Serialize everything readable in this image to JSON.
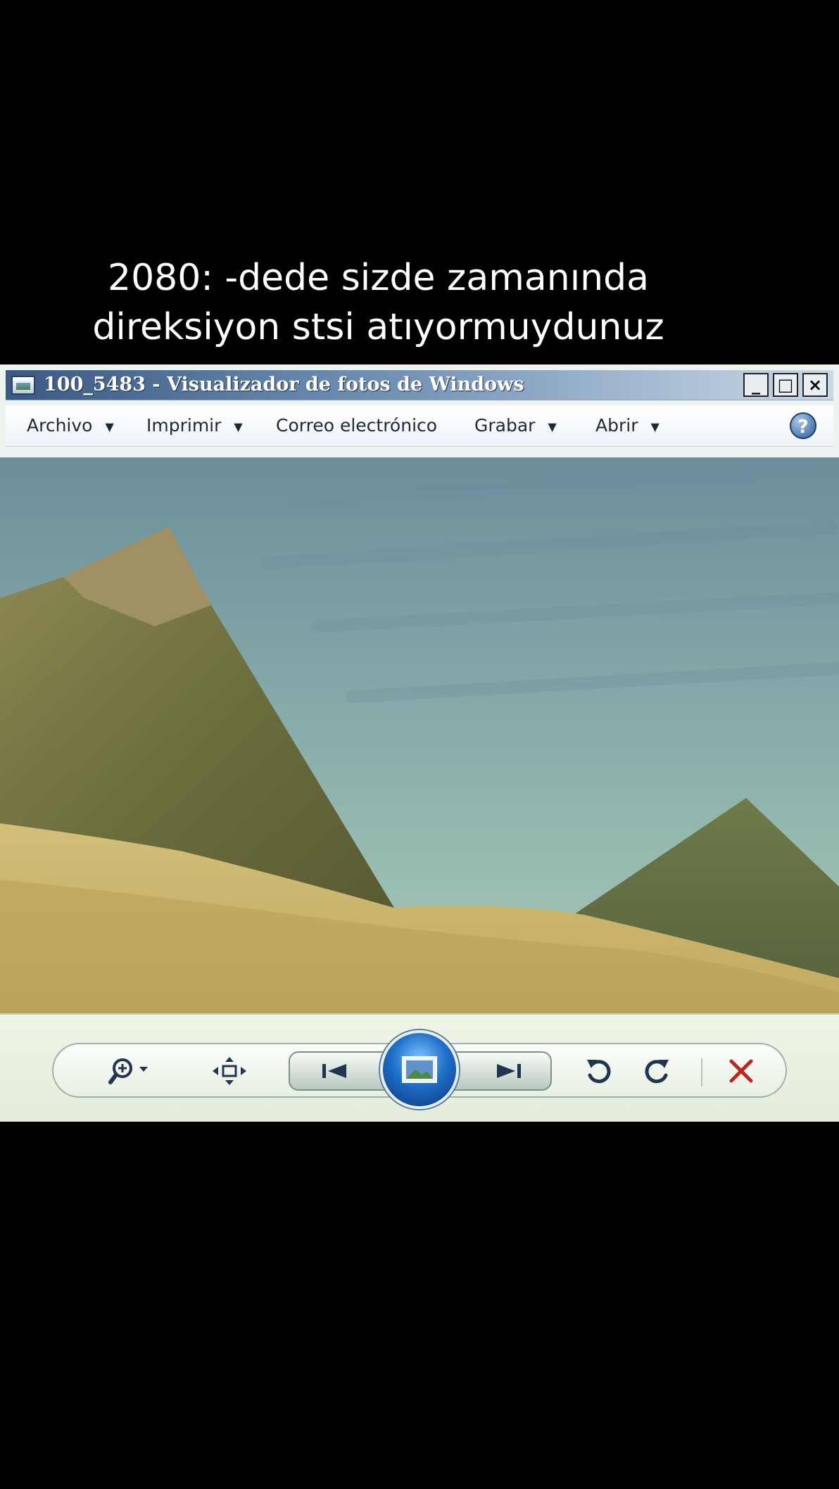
{
  "caption": {
    "line1": "2080: -dede sizde zamanında",
    "line2": "direksiyon stsi atıyormuydunuz"
  },
  "window": {
    "title": "100_5483 - Visualizador de fotos de Windows",
    "controls": {
      "minimize": "_",
      "maximize": "□",
      "close": "×"
    }
  },
  "menu": {
    "archivo": "Archivo",
    "imprimir": "Imprimir",
    "correo": "Correo electrónico",
    "grabar": "Grabar",
    "abrir": "Abrir",
    "dropdown_arrow": "▼",
    "help": "?"
  },
  "icons": {
    "zoom": "zoom-icon",
    "fit": "actual-size-icon",
    "previous": "previous-icon",
    "slideshow": "slideshow-icon",
    "next": "next-icon",
    "rotate_ccw": "rotate-counterclockwise-icon",
    "rotate_cw": "rotate-clockwise-icon",
    "delete": "delete-icon"
  },
  "colors": {
    "title_gradient_start": "#3a5a82",
    "sky": "#86aaa8",
    "sand": "#c9b26a",
    "delete_red": "#b8281e"
  }
}
